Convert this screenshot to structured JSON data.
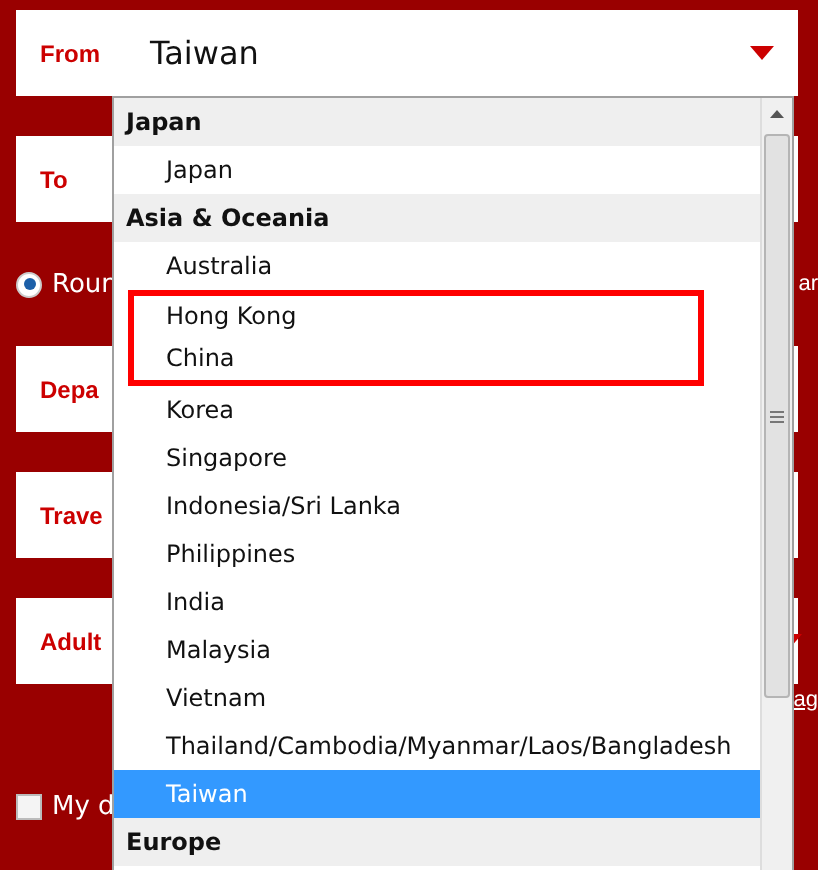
{
  "form": {
    "rows": [
      {
        "kind": "select",
        "label": "From",
        "value": "Taiwan"
      },
      {
        "kind": "field",
        "label": "To"
      },
      {
        "kind": "radio",
        "label": "Roun",
        "selected": true,
        "side_text": "ar"
      },
      {
        "kind": "field",
        "label": "Depa"
      },
      {
        "kind": "field",
        "label": "Trave"
      },
      {
        "kind": "select",
        "label": "Adult"
      },
      {
        "kind": "link",
        "label": "ag"
      },
      {
        "kind": "checkbox",
        "label": "My d",
        "checked": false
      }
    ]
  },
  "dropdown": {
    "options": [
      {
        "kind": "group",
        "label": "Japan"
      },
      {
        "kind": "option",
        "label": "Japan",
        "selected": false,
        "marked": false
      },
      {
        "kind": "group",
        "label": "Asia & Oceania"
      },
      {
        "kind": "option",
        "label": "Australia",
        "selected": false,
        "marked": false
      },
      {
        "kind": "option",
        "label": "Hong Kong",
        "selected": false,
        "marked": true
      },
      {
        "kind": "option",
        "label": "China",
        "selected": false,
        "marked": true
      },
      {
        "kind": "option",
        "label": "Korea",
        "selected": false,
        "marked": false
      },
      {
        "kind": "option",
        "label": "Singapore",
        "selected": false,
        "marked": false
      },
      {
        "kind": "option",
        "label": "Indonesia/Sri Lanka",
        "selected": false,
        "marked": false
      },
      {
        "kind": "option",
        "label": "Philippines",
        "selected": false,
        "marked": false
      },
      {
        "kind": "option",
        "label": "India",
        "selected": false,
        "marked": false
      },
      {
        "kind": "option",
        "label": "Malaysia",
        "selected": false,
        "marked": false
      },
      {
        "kind": "option",
        "label": "Vietnam",
        "selected": false,
        "marked": false
      },
      {
        "kind": "option",
        "label": "Thailand/Cambodia/Myanmar/Laos/Bangladesh",
        "selected": false,
        "marked": false
      },
      {
        "kind": "option",
        "label": "Taiwan",
        "selected": true,
        "marked": false
      },
      {
        "kind": "group",
        "label": "Europe"
      }
    ]
  }
}
